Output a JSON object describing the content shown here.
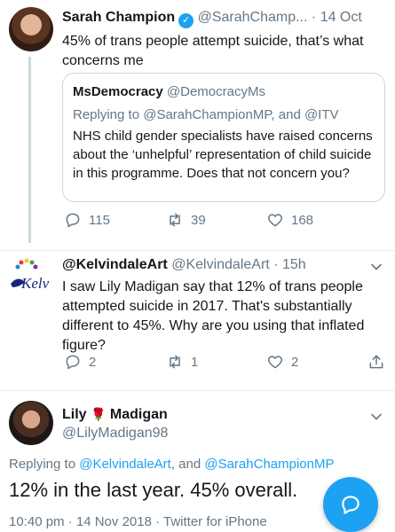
{
  "tweet1": {
    "name": "Sarah Champion",
    "handle": "@SarahChamp...",
    "dot": "·",
    "date": "14 Oct",
    "text": "45% of trans people attempt suicide, that’s what concerns me",
    "quoted": {
      "name": "MsDemocracy",
      "handle": "@DemocracyMs",
      "replying_prefix": "Replying to ",
      "replying_to_1": "@SarahChampionMP",
      "replying_and": ", and ",
      "replying_to_2": "@ITV",
      "text": "NHS child gender specialists have raised concerns about the ‘unhelpful’ representation of child suicide in this programme. Does that not concern you?"
    },
    "replies": "115",
    "retweets": "39",
    "likes": "168"
  },
  "tweet2": {
    "name": "@KelvindaleArt",
    "handle": "@KelvindaleArt",
    "dot": "·",
    "date": "15h",
    "avatar_text": "Kelv",
    "text": "I saw Lily Madigan say that 12% of trans people attempted suicide in 2017.  That's substantially different to 45%. Why are you using that inflated figure?",
    "replies": "2",
    "retweets": "1",
    "likes": "2"
  },
  "tweet3": {
    "name_first": "Lily",
    "name_emoji": "🌹",
    "name_last": "Madigan",
    "handle": "@LilyMadigan98",
    "replying_prefix": "Replying to ",
    "replying_to_1": "@KelvindaleArt",
    "replying_and": ", and ",
    "replying_to_2": "@SarahChampionMP",
    "text": "12% in the last year. 45% overall.",
    "timestamp": "10:40 pm · 14 Nov 2018 · Twitter for iPhone"
  },
  "icons": {
    "verified": "verified-badge-icon",
    "chevron": "chevron-down-icon",
    "reply": "reply-icon",
    "retweet": "retweet-icon",
    "like": "heart-icon",
    "share": "share-icon",
    "compose": "compose-reply-icon"
  },
  "colors": {
    "accent": "#1da1f2",
    "secondary_text": "#657786",
    "primary_text": "#14171a",
    "border": "#ccd6dd"
  }
}
